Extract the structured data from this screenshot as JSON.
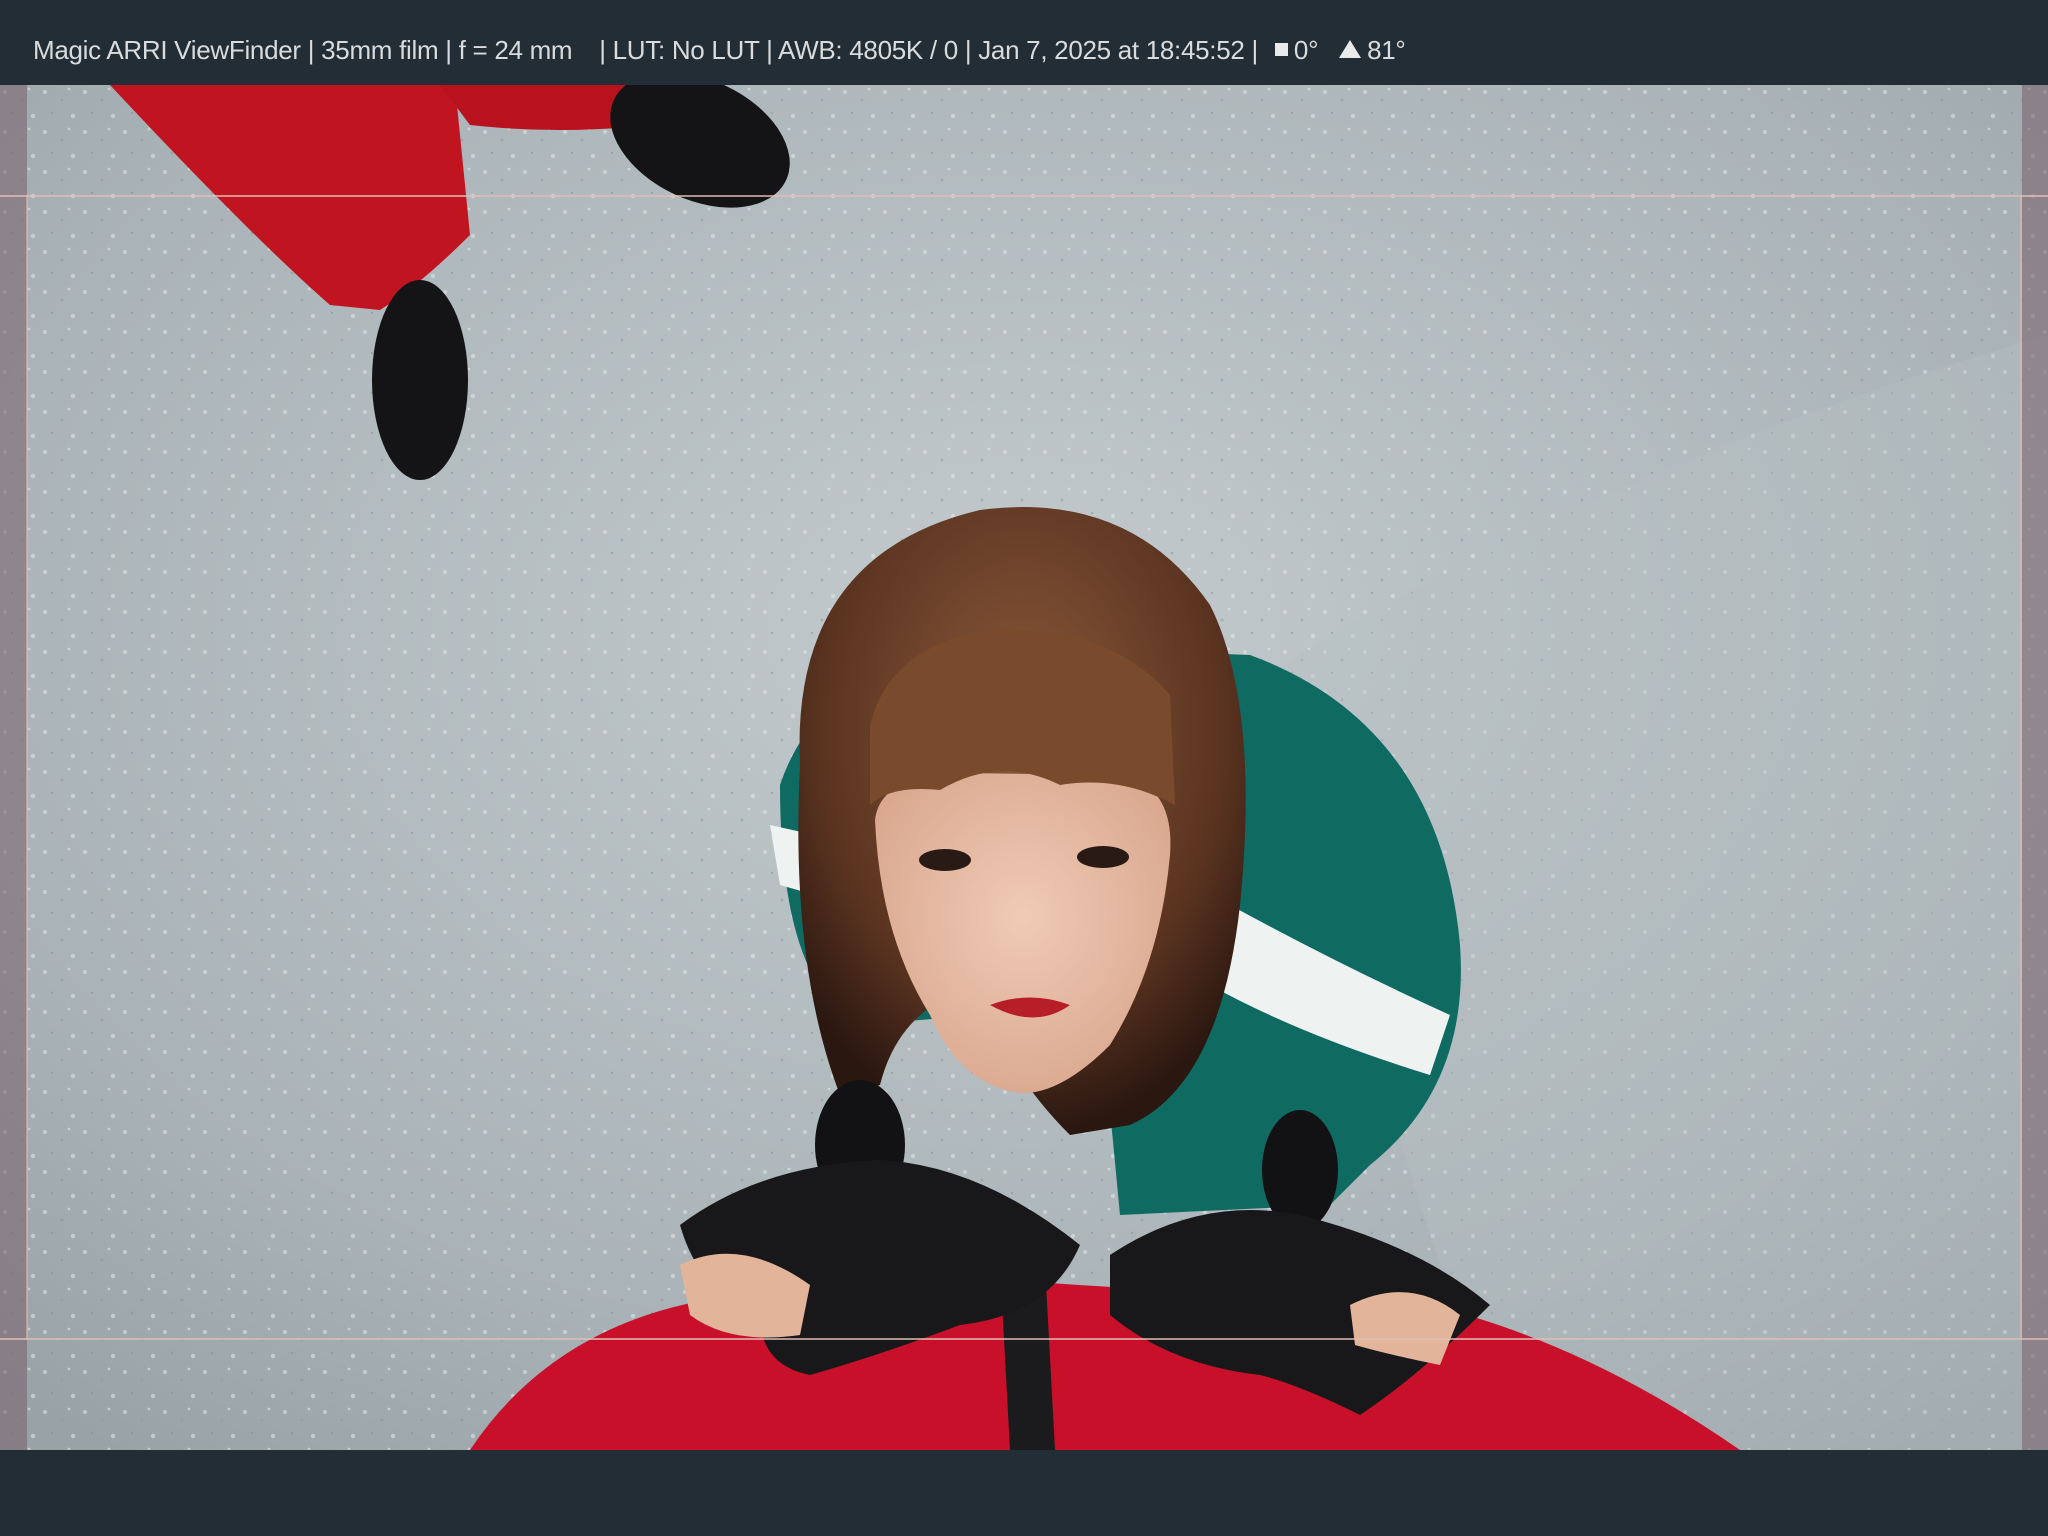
{
  "app": {
    "name": "Magic ARRI ViewFinder"
  },
  "status_bar": {
    "app_name": "Magic ARRI ViewFinder",
    "film_format": "35mm film",
    "focal_length": "f = 24 mm",
    "lut": "LUT: No LUT",
    "awb": "AWB: 4805K / 0",
    "timestamp": "Jan 7, 2025 at 18:45:52",
    "roll": "0°",
    "tilt": "81°",
    "separator": "|"
  },
  "icons": {
    "roll_indicator": "square-icon",
    "tilt_indicator": "triangle-icon"
  },
  "colors": {
    "bar_background": "#222d35",
    "bar_text": "#d8dcdf",
    "frame_guide": "#e1beb4",
    "side_mask": "#785f69"
  }
}
